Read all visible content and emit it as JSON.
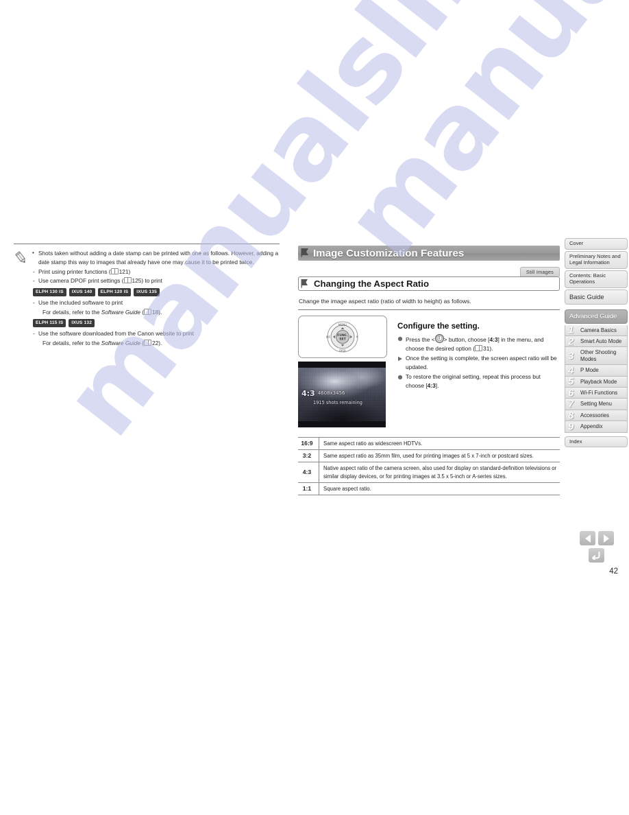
{
  "watermark": {
    "text": "manualslib.com"
  },
  "left_note": {
    "icon": "pencil-icon",
    "bullet": "Shots taken without adding a date stamp can be printed with one as follows. However, adding a date stamp this way to images that already have one may cause it to be printed twice.",
    "sub1": "Print using printer functions (",
    "sub1_ref": "121",
    "sub1_tail": ")",
    "sub2": "Use camera DPOF print settings (",
    "sub2_ref": "125",
    "sub2_tail": ") to print",
    "badges_row1": [
      "ELPH 130 IS",
      "IXUS 140",
      "ELPH 120 IS",
      "IXUS 135"
    ],
    "sub3": "Use the included software to print",
    "sub3_detail_pre": "For details, refer to the ",
    "sub3_detail_ital": "Software Guide",
    "sub3_detail_mid": " (",
    "sub3_ref": "18",
    "sub3_detail_tail": ").",
    "badges_row2": [
      "ELPH 115 IS",
      "IXUS 132"
    ],
    "sub4": "Use the software downloaded from the Canon website to print",
    "sub4_detail_pre": "For details, refer to the ",
    "sub4_detail_ital": "Software Guide",
    "sub4_detail_mid": " (",
    "sub4_ref": "22",
    "sub4_detail_tail": ")."
  },
  "main": {
    "h1": "Image Customization Features",
    "still_images_tab": "Still Images",
    "h2": "Changing the Aspect Ratio",
    "lead": "Change the image aspect ratio (ratio of width to height) as follows.",
    "figure": {
      "dial_labels": {
        "top": "MENU",
        "left": "MF",
        "right": "flash",
        "bottom": "DISP.",
        "center": "FUNC. SET"
      },
      "screen": {
        "ratio": "4:3",
        "resolution": "4608x3456",
        "remaining": "1915 shots remaining"
      }
    },
    "step_title": "Configure the setting.",
    "steps": [
      {
        "marker": "bullet-dot",
        "pre": "Press the <",
        "icon": "func-set-button-icon",
        "mid": "> button, choose [",
        "value": "4:3",
        "post": "] in the menu, and choose the desired option (",
        "ref": "31",
        "tail": ")."
      },
      {
        "marker": "arrow-triangle",
        "text": "Once the setting is complete, the screen aspect ratio will be updated."
      },
      {
        "marker": "bullet-dot",
        "pre": "To restore the original setting, repeat this process but choose [",
        "value": "4:3",
        "post": "]."
      }
    ],
    "ratio_table": [
      {
        "key": "16:9",
        "desc": "Same aspect ratio as widescreen HDTVs."
      },
      {
        "key": "3:2",
        "desc": "Same aspect ratio as 35mm film, used for printing images at 5 x 7-inch or postcard sizes."
      },
      {
        "key": "4:3",
        "desc": "Native aspect ratio of the camera screen, also used for display on standard-definition televisions or similar display devices, or for printing images at 3.5 x 5-inch or A-series sizes."
      },
      {
        "key": "1:1",
        "desc": "Square aspect ratio."
      }
    ]
  },
  "sidebar": {
    "top_items": [
      {
        "label": "Cover",
        "style": "plain"
      },
      {
        "label": "Preliminary Notes and Legal Information",
        "style": "plain"
      },
      {
        "label": "Contents: Basic Operations",
        "style": "plain"
      },
      {
        "label": "Basic Guide",
        "style": "big"
      },
      {
        "label": "Advanced Guide",
        "style": "advanced"
      }
    ],
    "chapters": [
      {
        "num": "1",
        "label": "Camera Basics"
      },
      {
        "num": "2",
        "label": "Smart Auto Mode"
      },
      {
        "num": "3",
        "label": "Other Shooting Modes"
      },
      {
        "num": "4",
        "label": "P Mode"
      },
      {
        "num": "5",
        "label": "Playback Mode"
      },
      {
        "num": "6",
        "label": "Wi-Fi Functions"
      },
      {
        "num": "7",
        "label": "Setting Menu"
      },
      {
        "num": "8",
        "label": "Accessories"
      },
      {
        "num": "9",
        "label": "Appendix"
      }
    ],
    "index_label": "Index"
  },
  "bottom_nav": {
    "prev": "previous-page",
    "next": "next-page",
    "back": "back",
    "page_number": "42"
  },
  "colors": {
    "header_bar": "#9a9a9a",
    "sidebar_active": "#b7b7b7",
    "badge_bg": "#3a3a3a",
    "watermark": "#b9bfe8"
  }
}
